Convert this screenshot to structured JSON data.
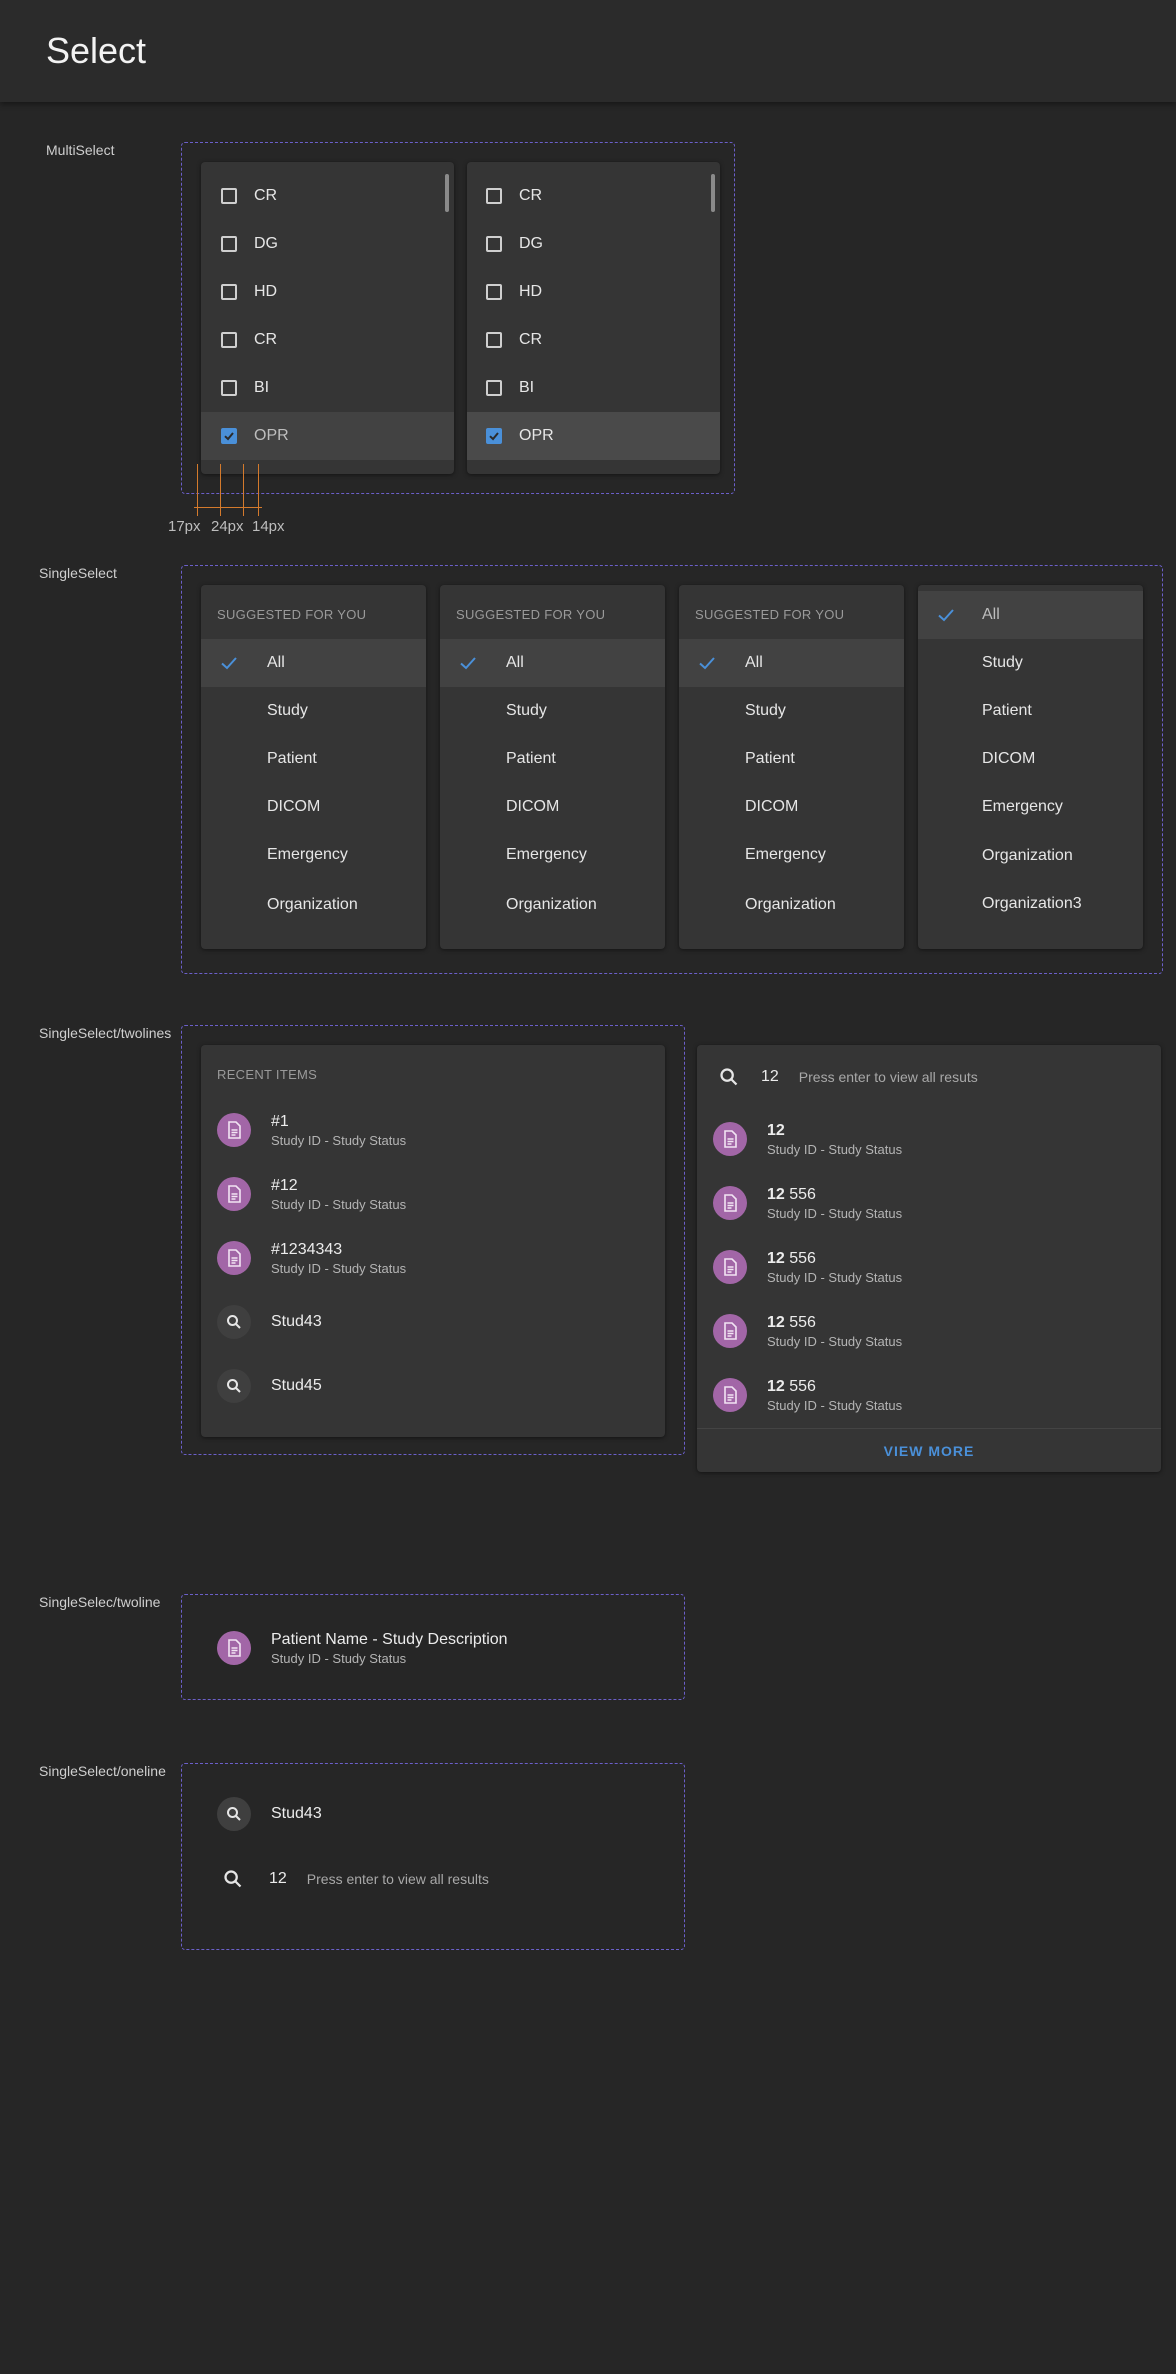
{
  "page_title": "Select",
  "sections": {
    "multiselect": "MultiSelect",
    "singleselect": "SingleSelect",
    "twolines": "SingleSelect/twolines",
    "twoline": "SingleSelec/twoline",
    "oneline": "SingleSelect/oneline"
  },
  "measurements": [
    "17px",
    "24px",
    "14px"
  ],
  "multiselect": {
    "items": [
      "CR",
      "DG",
      "HD",
      "CR",
      "BI",
      "OPR"
    ],
    "checked_index": 5
  },
  "singleselect": {
    "subheader": "SUGGESTED FOR YOU",
    "items": [
      "All",
      "Study",
      "Patient",
      "DICOM",
      "Emergency",
      "Organization"
    ],
    "panel4_items": [
      "All",
      "Study",
      "Patient",
      "DICOM",
      "Emergency",
      "Organization",
      "Organization3"
    ]
  },
  "recent": {
    "subheader": "RECENT ITEMS",
    "items": [
      {
        "title": "#1",
        "sub": "Study ID - Study Status"
      },
      {
        "title": "#12",
        "sub": "Study ID - Study Status"
      },
      {
        "title": "#1234343",
        "sub": "Study ID - Study Status"
      }
    ],
    "searches": [
      "Stud43",
      "Stud45"
    ]
  },
  "results": {
    "query": "12",
    "hint": "Press enter to view all resuts",
    "items": [
      {
        "bold": "12",
        "rest": "",
        "sub": "Study ID - Study Status"
      },
      {
        "bold": "12",
        "rest": " 556",
        "sub": "Study ID - Study Status"
      },
      {
        "bold": "12",
        "rest": " 556",
        "sub": "Study ID - Study Status"
      },
      {
        "bold": "12",
        "rest": " 556",
        "sub": "Study ID - Study Status"
      },
      {
        "bold": "12",
        "rest": " 556",
        "sub": "Study ID - Study Status"
      }
    ],
    "view_more": "VIEW MORE"
  },
  "twoline_item": {
    "title": "Patient Name - Study Description",
    "sub": "Study ID - Study Status"
  },
  "oneline": {
    "item1": "Stud43",
    "query": "12",
    "hint": "Press enter to view all results"
  },
  "colors": {
    "accent": "#4a90d9",
    "dash": "#6b5fc9",
    "avatar": "#a266a7"
  },
  "icons": [
    "checkbox-icon",
    "check-icon",
    "document-icon",
    "search-icon"
  ]
}
